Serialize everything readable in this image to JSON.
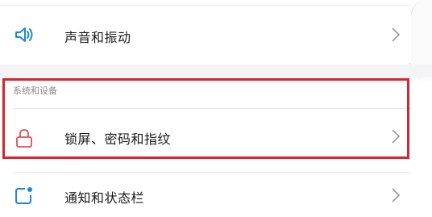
{
  "settings": {
    "sound_row": {
      "label": "声音和振动",
      "icon": "speaker-icon"
    },
    "section": {
      "title": "系统和设备"
    },
    "lock_row": {
      "label": "锁屏、密码和指纹",
      "icon": "lock-icon"
    },
    "notify_row": {
      "label": "通知和状态栏",
      "icon": "notification-icon"
    }
  },
  "colors": {
    "accent_blue": "#1f87d8",
    "lock_red": "#d9525e",
    "highlight_red": "#d7242f",
    "chevron": "#9a9a9a"
  }
}
